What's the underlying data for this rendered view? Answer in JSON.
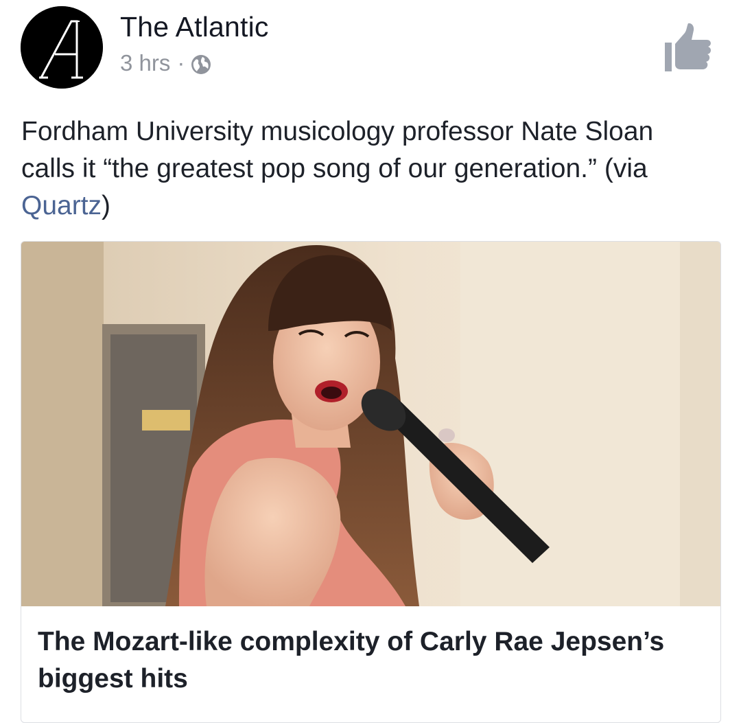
{
  "post": {
    "page_name": "The Atlantic",
    "timestamp": "3 hrs",
    "separator": "·",
    "privacy_icon": "globe-icon",
    "like_icon": "thumbs-up-icon",
    "text_before_link": "Fordham University musicology professor Nate Sloan calls it “the greatest pop song of our generation.” (via ",
    "link_text": "Quartz",
    "text_after_link": ")"
  },
  "link_card": {
    "title": "The Mozart-like complexity of Carly Rae Jepsen’s biggest hits"
  },
  "colors": {
    "name_text": "#141823",
    "meta_text": "#90949c",
    "link": "#4b6493",
    "body_text": "#1d2129"
  }
}
